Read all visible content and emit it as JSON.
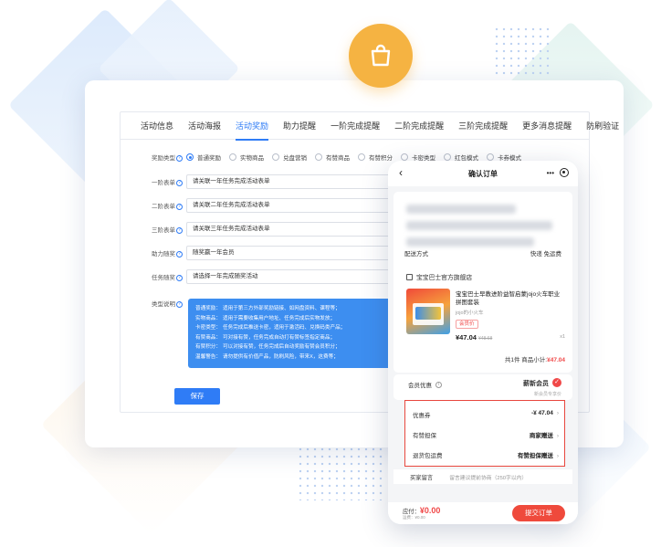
{
  "admin": {
    "tabs": [
      {
        "label": "活动信息"
      },
      {
        "label": "活动海报"
      },
      {
        "label": "活动奖励",
        "active": true
      },
      {
        "label": "助力提醒"
      },
      {
        "label": "一阶完成提醒"
      },
      {
        "label": "二阶完成提醒"
      },
      {
        "label": "三阶完成提醒"
      },
      {
        "label": "更多消息提醒"
      },
      {
        "label": "防刷验证"
      }
    ],
    "reward_type_label": "奖励类型",
    "reward_options": [
      {
        "label": "普通奖励",
        "selected": true
      },
      {
        "label": "实物商品"
      },
      {
        "label": "兑盘营销"
      },
      {
        "label": "有赞商品"
      },
      {
        "label": "有赞积分"
      },
      {
        "label": "卡密类型"
      },
      {
        "label": "红包模式"
      },
      {
        "label": "卡券模式"
      }
    ],
    "fields": [
      {
        "label": "一阶表单",
        "value": "请关联一年任务完成活动表单"
      },
      {
        "label": "二阶表单",
        "value": "请关联二年任务完成活动表单"
      },
      {
        "label": "三阶表单",
        "value": "请关联三年任务完成活动表单"
      },
      {
        "label": "助力随奖",
        "value": "随奖赢一年会员"
      },
      {
        "label": "任务随奖",
        "value": "请选择一年完成随奖活动"
      }
    ],
    "type_note_label": "类型说明",
    "type_notes": [
      {
        "k": "普通奖励：",
        "v": "适用于第三方外部奖励链接、如网盘资料、课程等；"
      },
      {
        "k": "实物商品：",
        "v": "适用于需要收集用户地址、任务完成后实物发放；"
      },
      {
        "k": "卡密类型：",
        "v": "任务完成后推送卡密，适用于激活码、兑换码类产品；"
      },
      {
        "k": "有赞商品：",
        "v": "可对接有赞，任务完成自动打有赞标签指定商品；"
      },
      {
        "k": "有赞积分：",
        "v": "可以对接有赞，任务完成后自动奖励有赞会员积分；"
      },
      {
        "k": "温馨警告：",
        "v": "请勿提供有价值产品，防刷风险，带来X，这费等；"
      }
    ],
    "save_label": "保存"
  },
  "phone": {
    "title": "确认订单",
    "back_icon": "‹",
    "more_dots": "•••",
    "shipping_label": "配送方式",
    "shipping_value": "快递 免运费",
    "shop_name": "宝宝巴士官方旗舰店",
    "product_name": "宝宝巴士早教进阶益智启蒙jojo火车职业拼图套装",
    "product_sub": "jojo的小火车",
    "product_tag": "会员价",
    "product_price": "¥47.04",
    "product_old_price": "¥48.68",
    "product_qty": "x1",
    "subtotal_prefix": "共1件  商品小计:",
    "subtotal_value": "¥47.04",
    "member_label": "会员优惠",
    "member_value": "薪新会员",
    "member_hint": "新会员专享价",
    "options": [
      {
        "label": "优惠券",
        "value": "-¥ 47.04"
      },
      {
        "label": "有赞担保",
        "value": "商家赠送"
      },
      {
        "label": "退货包运费",
        "value": "有赞担保赠送"
      }
    ],
    "note_label": "买家留言",
    "note_placeholder": "留言建议提前协商（250字以内）",
    "total_label": "应付：",
    "total_value": "¥0.00",
    "total_sub": "运费：¥0.00",
    "submit_label": "提交订单"
  },
  "colors": {
    "accent": "#2f7cf6",
    "brand_orange": "#f5b342",
    "red": "#ef4a3c"
  }
}
